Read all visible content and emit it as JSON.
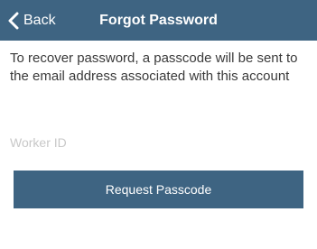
{
  "navbar": {
    "back_label": "Back",
    "back_icon": "chevron-left-icon",
    "title": "Forgot Password",
    "background_color": "#3e6482"
  },
  "main": {
    "instructions": "To recover password, a passcode will be sent to the email address associated with this account",
    "worker_id": {
      "value": "",
      "placeholder": "Worker ID"
    },
    "request_button_label": "Request Passcode",
    "button_color": "#3e6482"
  }
}
